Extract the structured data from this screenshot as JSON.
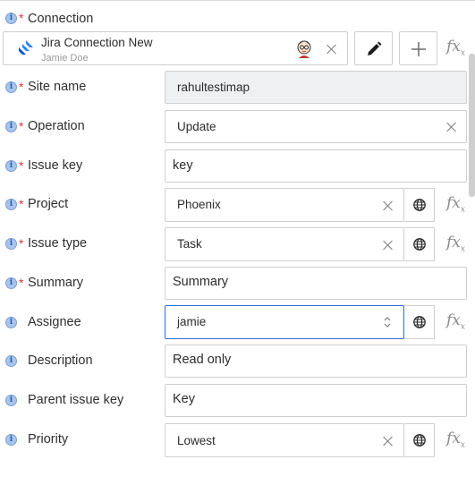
{
  "connection": {
    "label": "Connection",
    "name": "Jira Connection New",
    "user": "Jamie Doe"
  },
  "fields": {
    "site_name": {
      "label": "Site name",
      "value": "rahultestimap"
    },
    "operation": {
      "label": "Operation",
      "value": "Update"
    },
    "issue_key": {
      "label": "Issue key",
      "value": "key"
    },
    "project": {
      "label": "Project",
      "value": "Phoenix"
    },
    "issue_type": {
      "label": "Issue type",
      "value": "Task"
    },
    "summary": {
      "label": "Summary",
      "value": "Summary"
    },
    "assignee": {
      "label": "Assignee",
      "value": "jamie"
    },
    "description": {
      "label": "Description",
      "value": "Read only"
    },
    "parent_issue_key": {
      "label": "Parent issue key",
      "value": "Key"
    },
    "priority": {
      "label": "Priority",
      "value": "Lowest"
    }
  },
  "icons": {
    "info": "info-icon",
    "required": "*",
    "fx": "fx",
    "fx_sub": "x"
  },
  "colors": {
    "accent": "#2f6fd6",
    "required": "#d9363e",
    "jira": "#2684ff"
  }
}
